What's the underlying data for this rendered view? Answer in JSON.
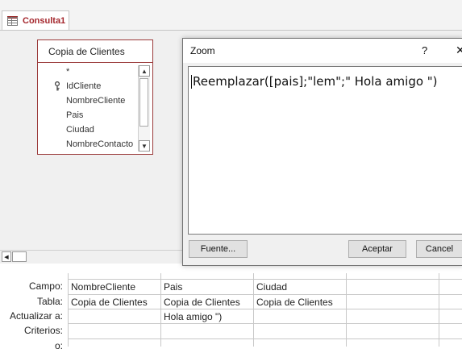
{
  "tab": {
    "label": "Consulta1"
  },
  "table": {
    "title": "Copia de Clientes",
    "fields": [
      "*",
      "IdCliente",
      "NombreCliente",
      "Pais",
      "Ciudad",
      "NombreContacto"
    ]
  },
  "zoom": {
    "title": "Zoom",
    "help": "?",
    "close": "✕",
    "expression": "Reemplazar([pais];\"lem\";\" Hola amigo \")",
    "font_button": "Fuente...",
    "ok_button": "Aceptar",
    "cancel_button": "Cancel"
  },
  "grid": {
    "row_labels": [
      "Campo:",
      "Tabla:",
      "Actualizar a:",
      "Criterios:",
      "o:"
    ],
    "columns": [
      {
        "field": "NombreCliente",
        "table": "Copia de Clientes",
        "update": ""
      },
      {
        "field": "Pais",
        "table": "Copia de Clientes",
        "update": " Hola amigo \")"
      },
      {
        "field": "Ciudad",
        "table": "Copia de Clientes",
        "update": ""
      }
    ]
  },
  "colors": {
    "accent": "#a4262c",
    "table_border": "#9b3b3b"
  }
}
